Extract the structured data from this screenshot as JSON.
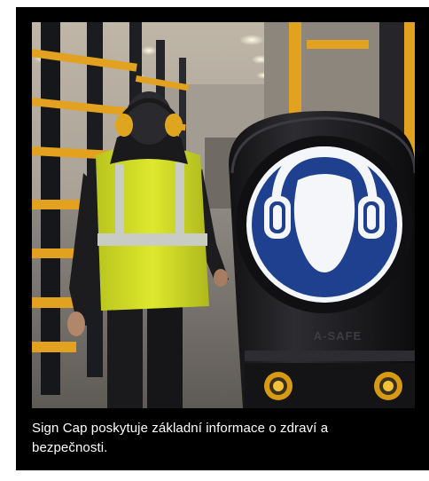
{
  "figure": {
    "caption": "Sign Cap poskytuje základní informace o zdraví a bezpečnosti.",
    "post_brand_text": "A-SAFE",
    "sign_icon": "hearing-protection-icon",
    "colors": {
      "card_background": "#000000",
      "caption_text": "#ffffff",
      "sign_blue": "#1f3f8f",
      "sign_white": "#f4f6fa",
      "post_black": "#1c1c1e",
      "rack_orange": "#e2a21f",
      "vest_yellow": "#d9e62a"
    }
  }
}
